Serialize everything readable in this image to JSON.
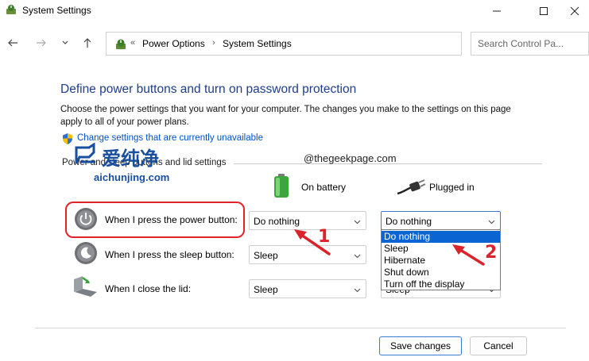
{
  "window": {
    "title": "System Settings",
    "controls": {
      "minimize": "minimize-icon",
      "maximize": "maximize-icon",
      "close": "close-icon"
    }
  },
  "nav": {
    "back": "back-arrow-icon",
    "forward": "forward-arrow-icon",
    "recent": "chevron-down-icon",
    "up": "up-arrow-icon",
    "address": {
      "prefix": "«",
      "crumbs": [
        "Power Options",
        "System Settings"
      ],
      "separator": "›"
    },
    "search_placeholder": "Search Control Pa..."
  },
  "content": {
    "heading": "Define power buttons and turn on password protection",
    "description": "Choose the power settings that you want for your computer. The changes you make to the settings on this page apply to all of your power plans.",
    "change_link": "Change settings that are currently unavailable",
    "section_label": "Power and sleep buttons and lid settings",
    "columns": {
      "battery": "On battery",
      "plugged": "Plugged in"
    },
    "rows": [
      {
        "label": "When I press the power button:",
        "battery": "Do nothing",
        "plugged": "Do nothing"
      },
      {
        "label": "When I press the sleep button:",
        "battery": "Sleep",
        "plugged": "Sleep"
      },
      {
        "label": "When I close the lid:",
        "battery": "Sleep",
        "plugged": "Sleep"
      }
    ],
    "dropdown_options": [
      "Do nothing",
      "Sleep",
      "Hibernate",
      "Shut down",
      "Turn off the display"
    ],
    "dropdown_selected": "Do nothing"
  },
  "buttons": {
    "save": "Save changes",
    "cancel": "Cancel"
  },
  "overlay": {
    "watermark_cn": "爱纯净",
    "watermark_url": "aichunjing.com",
    "watermark_site": "@thegeekpage.com",
    "annotation_1": "1",
    "annotation_2": "2"
  },
  "colors": {
    "accent": "#0a64d2",
    "heading": "#1f3e88",
    "link": "#0050c8",
    "annotation": "#e0242a"
  }
}
